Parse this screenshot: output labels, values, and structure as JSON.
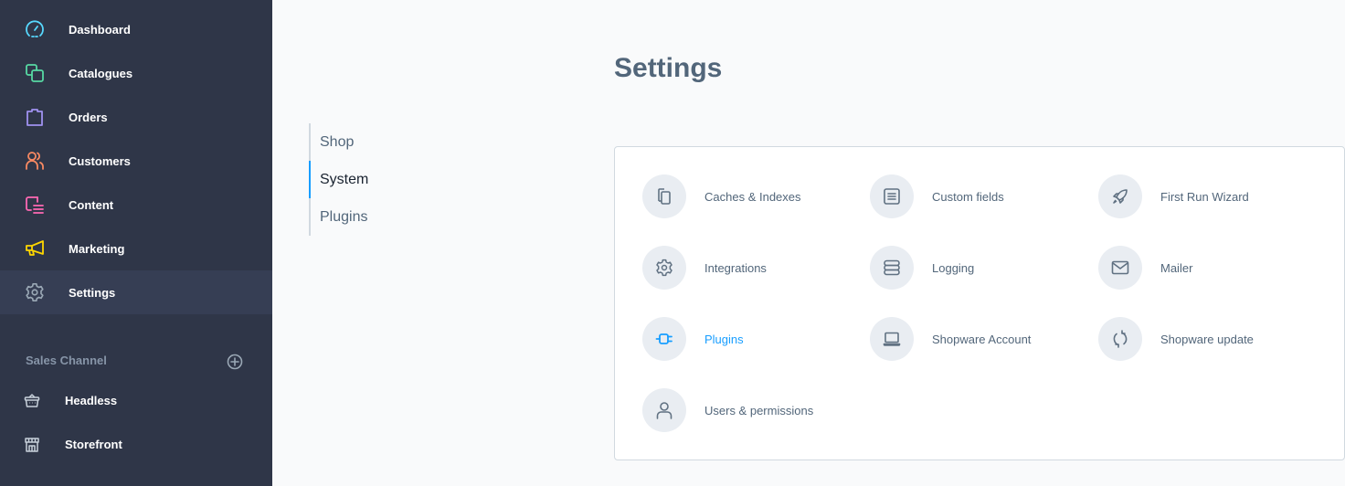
{
  "sidebar": {
    "items": [
      {
        "label": "Dashboard",
        "icon": "dashboard-icon",
        "color": "#57d9ff"
      },
      {
        "label": "Catalogues",
        "icon": "catalogues-icon",
        "color": "#57d9a3"
      },
      {
        "label": "Orders",
        "icon": "orders-icon",
        "color": "#a092f0"
      },
      {
        "label": "Customers",
        "icon": "customers-icon",
        "color": "#f88962"
      },
      {
        "label": "Content",
        "icon": "content-icon",
        "color": "#ff68b4"
      },
      {
        "label": "Marketing",
        "icon": "marketing-icon",
        "color": "#ffd700"
      },
      {
        "label": "Settings",
        "icon": "settings-icon",
        "color": "#9aa8b5",
        "active": true
      }
    ],
    "sales_channel": {
      "header": "Sales Channel",
      "add_icon": "add-circle-icon",
      "items": [
        {
          "label": "Headless",
          "icon": "basket-icon"
        },
        {
          "label": "Storefront",
          "icon": "storefront-icon"
        }
      ]
    }
  },
  "page": {
    "title": "Settings",
    "tabs": [
      {
        "label": "Shop"
      },
      {
        "label": "System",
        "active": true
      },
      {
        "label": "Plugins"
      }
    ]
  },
  "settings_grid": {
    "items": [
      {
        "label": "Caches & Indexes",
        "icon": "documents-icon"
      },
      {
        "label": "Custom fields",
        "icon": "list-icon"
      },
      {
        "label": "First Run Wizard",
        "icon": "rocket-icon"
      },
      {
        "label": "Integrations",
        "icon": "gear-icon"
      },
      {
        "label": "Logging",
        "icon": "database-icon"
      },
      {
        "label": "Mailer",
        "icon": "envelope-icon"
      },
      {
        "label": "Plugins",
        "icon": "plug-icon",
        "active": true
      },
      {
        "label": "Shopware Account",
        "icon": "laptop-icon"
      },
      {
        "label": "Shopware update",
        "icon": "refresh-icon"
      },
      {
        "label": "Users & permissions",
        "icon": "user-icon"
      }
    ]
  },
  "colors": {
    "accent": "#189eff",
    "sidebar_bg": "#2f3648",
    "text_muted": "#52667a"
  }
}
